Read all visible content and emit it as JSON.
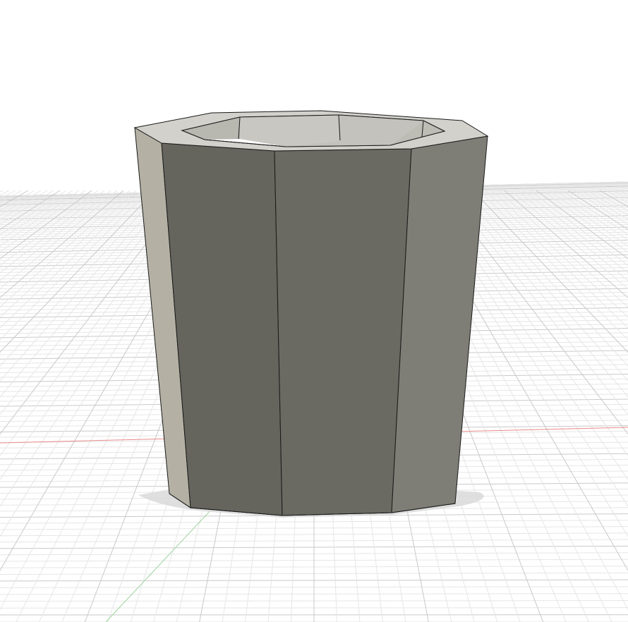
{
  "viewport": {
    "background": "#ffffff",
    "description_free": true
  },
  "grid": {
    "minor_color": "#e6e6e6",
    "major_color": "#c9c9c9",
    "x_axis_color": "#e88a8a",
    "y_axis_color": "#9fd39f"
  },
  "model": {
    "shape": "octagonal-tapered-cup",
    "colors": {
      "front_face": "#67675f",
      "front_right_face": "#6a6a62",
      "front_left_face": "#65655e",
      "right_face": "#7e7e76",
      "left_face": "#b4b1a4",
      "rim_top": "#d2d1cb",
      "inner_wall": "#c8c7c1",
      "inner_wall_dark": "#b8b7b0",
      "edge": "#1a1a1a",
      "shadow": "#d9d9d9"
    }
  }
}
